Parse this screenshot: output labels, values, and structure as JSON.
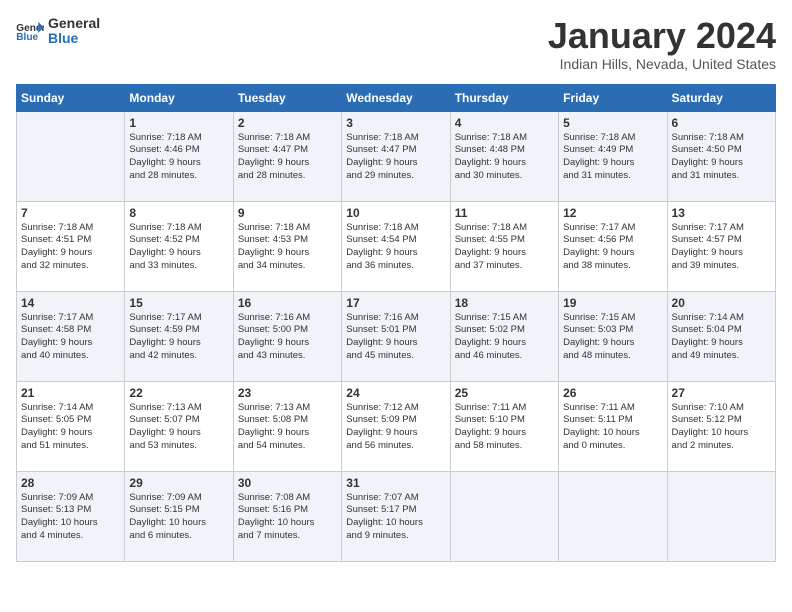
{
  "header": {
    "logo_general": "General",
    "logo_blue": "Blue",
    "title": "January 2024",
    "subtitle": "Indian Hills, Nevada, United States"
  },
  "days_of_week": [
    "Sunday",
    "Monday",
    "Tuesday",
    "Wednesday",
    "Thursday",
    "Friday",
    "Saturday"
  ],
  "weeks": [
    [
      {
        "day": "",
        "content": ""
      },
      {
        "day": "1",
        "content": "Sunrise: 7:18 AM\nSunset: 4:46 PM\nDaylight: 9 hours\nand 28 minutes."
      },
      {
        "day": "2",
        "content": "Sunrise: 7:18 AM\nSunset: 4:47 PM\nDaylight: 9 hours\nand 28 minutes."
      },
      {
        "day": "3",
        "content": "Sunrise: 7:18 AM\nSunset: 4:47 PM\nDaylight: 9 hours\nand 29 minutes."
      },
      {
        "day": "4",
        "content": "Sunrise: 7:18 AM\nSunset: 4:48 PM\nDaylight: 9 hours\nand 30 minutes."
      },
      {
        "day": "5",
        "content": "Sunrise: 7:18 AM\nSunset: 4:49 PM\nDaylight: 9 hours\nand 31 minutes."
      },
      {
        "day": "6",
        "content": "Sunrise: 7:18 AM\nSunset: 4:50 PM\nDaylight: 9 hours\nand 31 minutes."
      }
    ],
    [
      {
        "day": "7",
        "content": "Sunrise: 7:18 AM\nSunset: 4:51 PM\nDaylight: 9 hours\nand 32 minutes."
      },
      {
        "day": "8",
        "content": "Sunrise: 7:18 AM\nSunset: 4:52 PM\nDaylight: 9 hours\nand 33 minutes."
      },
      {
        "day": "9",
        "content": "Sunrise: 7:18 AM\nSunset: 4:53 PM\nDaylight: 9 hours\nand 34 minutes."
      },
      {
        "day": "10",
        "content": "Sunrise: 7:18 AM\nSunset: 4:54 PM\nDaylight: 9 hours\nand 36 minutes."
      },
      {
        "day": "11",
        "content": "Sunrise: 7:18 AM\nSunset: 4:55 PM\nDaylight: 9 hours\nand 37 minutes."
      },
      {
        "day": "12",
        "content": "Sunrise: 7:17 AM\nSunset: 4:56 PM\nDaylight: 9 hours\nand 38 minutes."
      },
      {
        "day": "13",
        "content": "Sunrise: 7:17 AM\nSunset: 4:57 PM\nDaylight: 9 hours\nand 39 minutes."
      }
    ],
    [
      {
        "day": "14",
        "content": "Sunrise: 7:17 AM\nSunset: 4:58 PM\nDaylight: 9 hours\nand 40 minutes."
      },
      {
        "day": "15",
        "content": "Sunrise: 7:17 AM\nSunset: 4:59 PM\nDaylight: 9 hours\nand 42 minutes."
      },
      {
        "day": "16",
        "content": "Sunrise: 7:16 AM\nSunset: 5:00 PM\nDaylight: 9 hours\nand 43 minutes."
      },
      {
        "day": "17",
        "content": "Sunrise: 7:16 AM\nSunset: 5:01 PM\nDaylight: 9 hours\nand 45 minutes."
      },
      {
        "day": "18",
        "content": "Sunrise: 7:15 AM\nSunset: 5:02 PM\nDaylight: 9 hours\nand 46 minutes."
      },
      {
        "day": "19",
        "content": "Sunrise: 7:15 AM\nSunset: 5:03 PM\nDaylight: 9 hours\nand 48 minutes."
      },
      {
        "day": "20",
        "content": "Sunrise: 7:14 AM\nSunset: 5:04 PM\nDaylight: 9 hours\nand 49 minutes."
      }
    ],
    [
      {
        "day": "21",
        "content": "Sunrise: 7:14 AM\nSunset: 5:05 PM\nDaylight: 9 hours\nand 51 minutes."
      },
      {
        "day": "22",
        "content": "Sunrise: 7:13 AM\nSunset: 5:07 PM\nDaylight: 9 hours\nand 53 minutes."
      },
      {
        "day": "23",
        "content": "Sunrise: 7:13 AM\nSunset: 5:08 PM\nDaylight: 9 hours\nand 54 minutes."
      },
      {
        "day": "24",
        "content": "Sunrise: 7:12 AM\nSunset: 5:09 PM\nDaylight: 9 hours\nand 56 minutes."
      },
      {
        "day": "25",
        "content": "Sunrise: 7:11 AM\nSunset: 5:10 PM\nDaylight: 9 hours\nand 58 minutes."
      },
      {
        "day": "26",
        "content": "Sunrise: 7:11 AM\nSunset: 5:11 PM\nDaylight: 10 hours\nand 0 minutes."
      },
      {
        "day": "27",
        "content": "Sunrise: 7:10 AM\nSunset: 5:12 PM\nDaylight: 10 hours\nand 2 minutes."
      }
    ],
    [
      {
        "day": "28",
        "content": "Sunrise: 7:09 AM\nSunset: 5:13 PM\nDaylight: 10 hours\nand 4 minutes."
      },
      {
        "day": "29",
        "content": "Sunrise: 7:09 AM\nSunset: 5:15 PM\nDaylight: 10 hours\nand 6 minutes."
      },
      {
        "day": "30",
        "content": "Sunrise: 7:08 AM\nSunset: 5:16 PM\nDaylight: 10 hours\nand 7 minutes."
      },
      {
        "day": "31",
        "content": "Sunrise: 7:07 AM\nSunset: 5:17 PM\nDaylight: 10 hours\nand 9 minutes."
      },
      {
        "day": "",
        "content": ""
      },
      {
        "day": "",
        "content": ""
      },
      {
        "day": "",
        "content": ""
      }
    ]
  ]
}
